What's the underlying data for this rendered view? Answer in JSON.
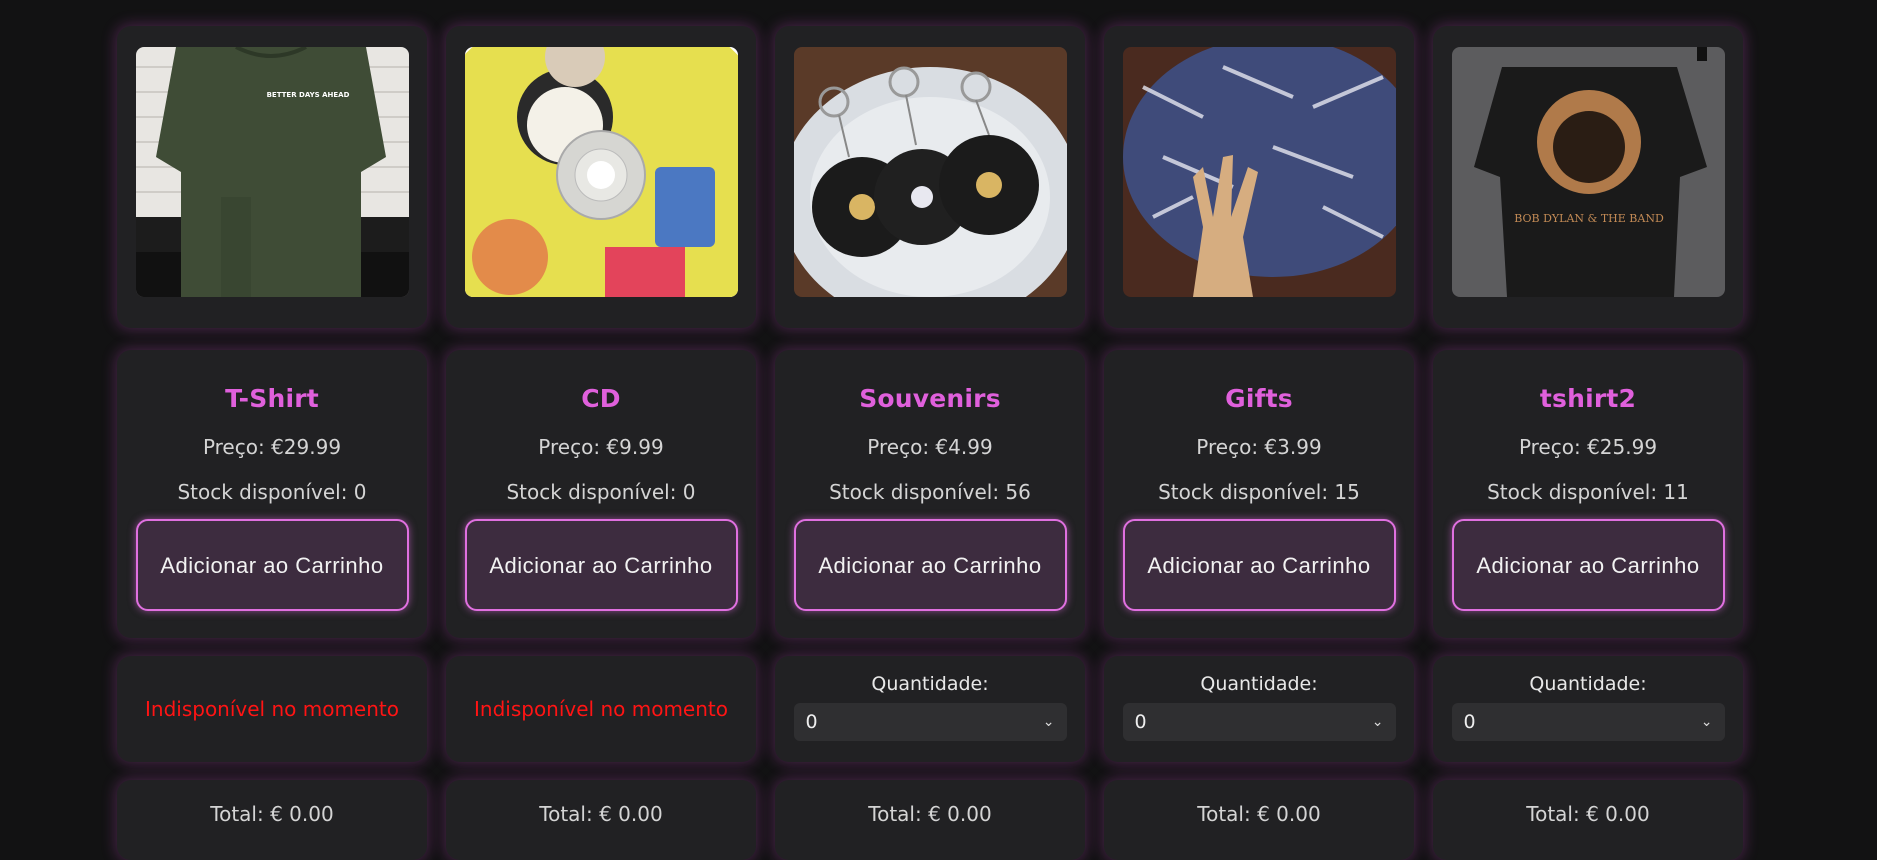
{
  "products": [
    {
      "image_alt": "Green t-shirt",
      "title": "T-Shirt",
      "price": "Preço: €29.99",
      "stock": "Stock disponível: 0",
      "add_label": "Adicionar ao Carrinho",
      "available": false,
      "unavailable_text": "Indisponível no momento",
      "total": "Total: € 0.00",
      "shirt_text": "BETTER DAYS AHEAD"
    },
    {
      "image_alt": "CD",
      "title": "CD",
      "price": "Preço: €9.99",
      "stock": "Stock disponível: 0",
      "add_label": "Adicionar ao Carrinho",
      "available": false,
      "unavailable_text": "Indisponível no momento",
      "total": "Total: € 0.00"
    },
    {
      "image_alt": "Vinyl record keychains",
      "title": "Souvenirs",
      "price": "Preço: €4.99",
      "stock": "Stock disponível: 56",
      "add_label": "Adicionar ao Carrinho",
      "available": true,
      "qty_label": "Quantidade:",
      "qty_value": "0",
      "total": "Total: € 0.00"
    },
    {
      "image_alt": "Wristbands in a bowl",
      "title": "Gifts",
      "price": "Preço: €3.99",
      "stock": "Stock disponível: 15",
      "add_label": "Adicionar ao Carrinho",
      "available": true,
      "qty_label": "Quantidade:",
      "qty_value": "0",
      "total": "Total: € 0.00"
    },
    {
      "image_alt": "Black Bob Dylan t-shirt",
      "title": "tshirt2",
      "price": "Preço: €25.99",
      "stock": "Stock disponível: 11",
      "add_label": "Adicionar ao Carrinho",
      "available": true,
      "qty_label": "Quantidade:",
      "qty_value": "0",
      "total": "Total: € 0.00",
      "shirt_text": "BOB DYLAN & THE BAND"
    }
  ],
  "colors": {
    "accent": "#e060dc",
    "button_bg": "#3d2c3f",
    "unavailable": "#ff1414",
    "card_bg": "#212123"
  }
}
